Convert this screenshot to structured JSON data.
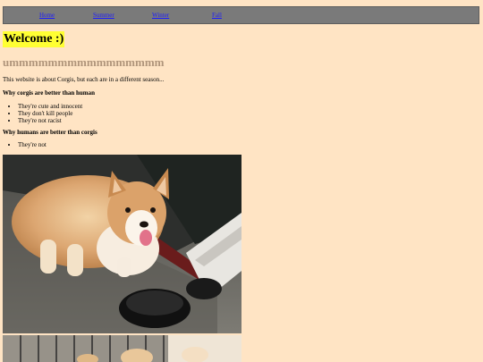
{
  "nav": {
    "home": "Home",
    "summer": "Summer",
    "winter": "Winter",
    "fall": "Fall"
  },
  "welcome": "Welcome :)",
  "subheading": "ummmmmmmmmmmmmmmm",
  "intro": "This website is about Corgis, but each are in a different season...",
  "section_corgis": {
    "heading": "Why corgis are better than human",
    "items": [
      "They're cute and innocent",
      "They don't kill people",
      "They're not racist"
    ]
  },
  "section_humans": {
    "heading": "Why humans are better than corgis",
    "items": [
      "They're not"
    ]
  },
  "colors": {
    "page_background": "#ffe4c4",
    "navbar": "#7a7a7a",
    "welcome_highlight": "#ffff33",
    "subheading": "#b0957b",
    "link": "#1a1aff"
  }
}
